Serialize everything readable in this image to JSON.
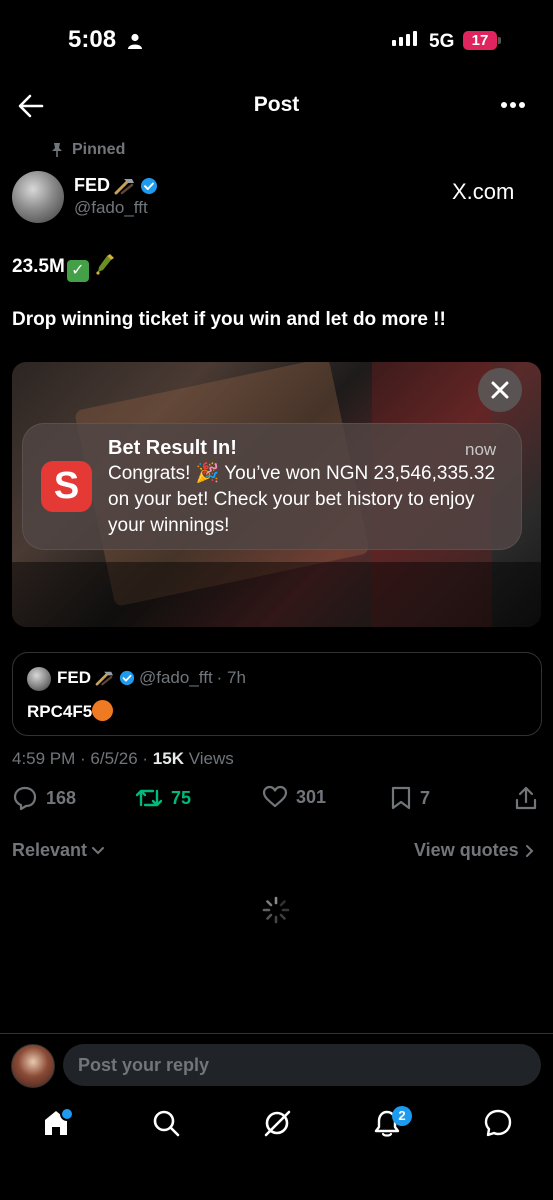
{
  "status_bar": {
    "time": "5:08",
    "network": "5G",
    "battery": "17"
  },
  "header": {
    "title": "Post"
  },
  "post": {
    "pinned_label": "Pinned",
    "author_name": "FED",
    "author_handle": "@fado_fft",
    "source": "X.com",
    "stat_line": "23.5M",
    "body": "Drop winning ticket if you win and let do more !!",
    "media_notification": {
      "title": "Bet Result In!",
      "time": "now",
      "body": "Congrats! 🎉 You’ve won NGN 23,546,335.32 on your bet! Check your bet history to enjoy your winnings!",
      "app_letter": "S"
    },
    "quoted": {
      "author_name": "FED",
      "author_handle": "@fado_fft",
      "age": "· 7h",
      "text": "RPC4F5"
    },
    "timestamp": "4:59 PM · 6/5/26 · ",
    "views_count": "15K",
    "views_label": " Views",
    "actions": {
      "replies": "168",
      "reposts": "75",
      "likes": "301",
      "bookmarks": "7"
    }
  },
  "filter": {
    "relevant": "Relevant",
    "view_quotes": "View quotes"
  },
  "reply": {
    "placeholder": "Post your reply"
  },
  "tabbar": {
    "notifications_badge": "2"
  },
  "colors": {
    "accent": "#1d9bf0",
    "repost_green": "#00ba7c",
    "app_red": "#e53935"
  }
}
